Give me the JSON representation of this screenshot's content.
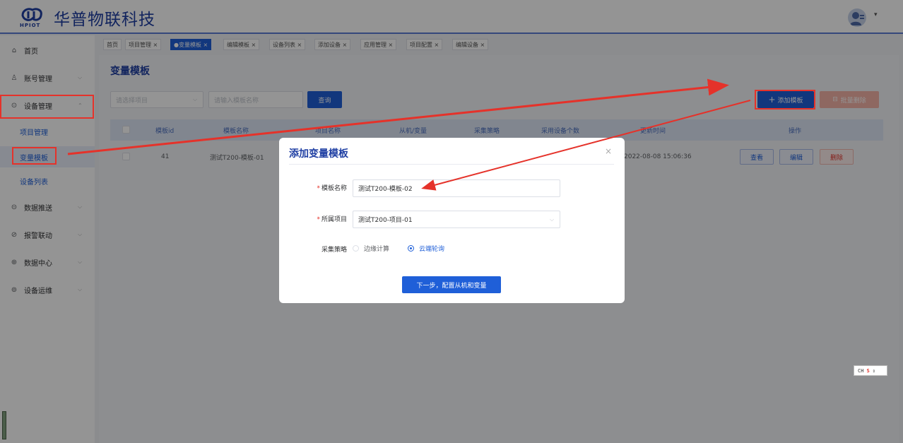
{
  "app": {
    "brand_text": "华普物联科技",
    "logo_label": "HPIOT"
  },
  "sidebar": {
    "items": [
      {
        "label": "首页",
        "icon": "home-icon"
      },
      {
        "label": "账号管理",
        "icon": "user-icon"
      },
      {
        "label": "设备管理",
        "icon": "device-icon"
      },
      {
        "label": "数据推送",
        "icon": "push-icon"
      },
      {
        "label": "报警联动",
        "icon": "alarm-icon"
      },
      {
        "label": "数据中心",
        "icon": "data-center-icon"
      },
      {
        "label": "设备运维",
        "icon": "maintenance-icon"
      }
    ],
    "sub_items": [
      "项目管理",
      "变量模板",
      "设备列表"
    ]
  },
  "tags": [
    "首页",
    "项目管理",
    "变量模板",
    "编辑模板",
    "设备列表",
    "添加设备",
    "应用管理",
    "项目配置",
    "编辑设备"
  ],
  "page": {
    "title": "变量模板",
    "select_project_placeholder": "请选择项目",
    "search_placeholder": "请输入模板名称",
    "query_label": "查询",
    "add_label": "添加模板",
    "batch_delete_label": "批量删除"
  },
  "table": {
    "columns": [
      "模板id",
      "模板名称",
      "项目名称",
      "从机/变量",
      "采集策略",
      "采用设备个数",
      "更新时间",
      "操作"
    ],
    "rows": [
      {
        "id": "41",
        "name": "测试T200-模板-01",
        "updated": "2022-08-08 15:06:36"
      }
    ],
    "actions": {
      "view": "查看",
      "edit": "编辑",
      "delete": "删除"
    }
  },
  "dialog": {
    "title": "添加变量模板",
    "name_label": "模板名称",
    "name_value": "测试T200-模板-02",
    "project_label": "所属项目",
    "project_value": "测试T200-项目-01",
    "strategy_label": "采集策略",
    "strategy_options": [
      "边缘计算",
      "云端轮询"
    ],
    "strategy_selected": "云端轮询",
    "next_label": "下一步，配置从机和变量"
  },
  "ime": {
    "text": "CH"
  },
  "colors": {
    "brand": "#1f3fa3",
    "primary": "#1f5fd8",
    "annotation": "#e5322a"
  }
}
